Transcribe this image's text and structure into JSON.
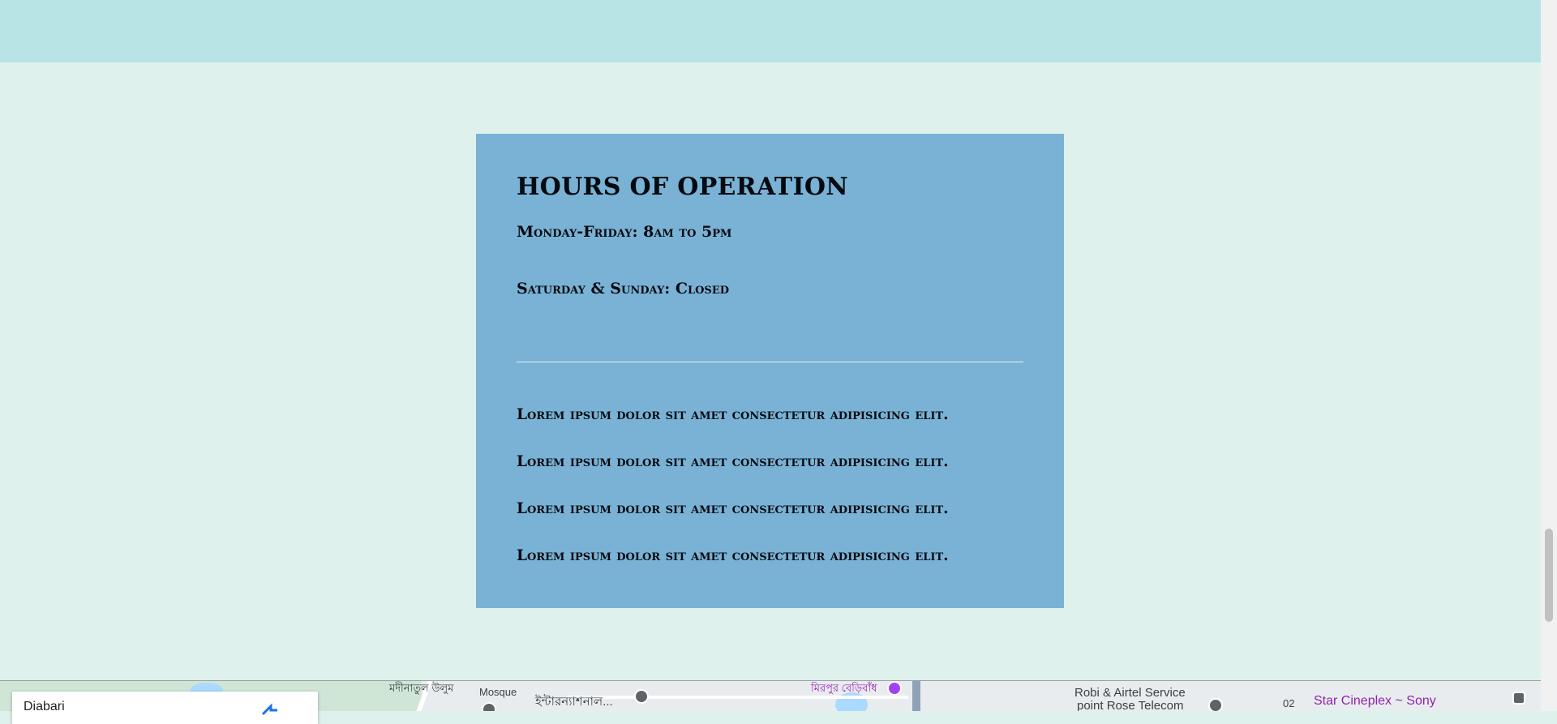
{
  "hours": {
    "title": "HOURS OF OPERATION",
    "weekday": "Monday-Friday: 8am to 5pm",
    "weekend": "Saturday & Sunday: Closed"
  },
  "notes": [
    "Lorem ipsum dolor sit amet consectetur adipisicing elit.",
    "Lorem ipsum dolor sit amet consectetur adipisicing elit.",
    "Lorem ipsum dolor sit amet consectetur adipisicing elit.",
    "Lorem ipsum dolor sit amet consectetur adipisicing elit."
  ],
  "map": {
    "info_card_place": "Diabari",
    "labels": {
      "mosque": "Mosque",
      "bn_1": "মদীনাতুল উলুম",
      "bn_2": "ইন্টারন্যাশনাল...",
      "bn_3": "মিরপুর বেড়িবাঁধ",
      "robi_1": "Robi & Airtel Service",
      "robi_2": "point Rose Telecom",
      "cineplex": "Star Cineplex ~ Sony",
      "road_num": "02"
    },
    "icons": [
      "school-icon",
      "place-pin-icon",
      "directions-icon",
      "transit-icon"
    ]
  },
  "colors": {
    "top_band": "#b9e4e6",
    "page_bg": "#dff1ec",
    "card_bg": "#7ab2d5",
    "text": "#050a10"
  }
}
